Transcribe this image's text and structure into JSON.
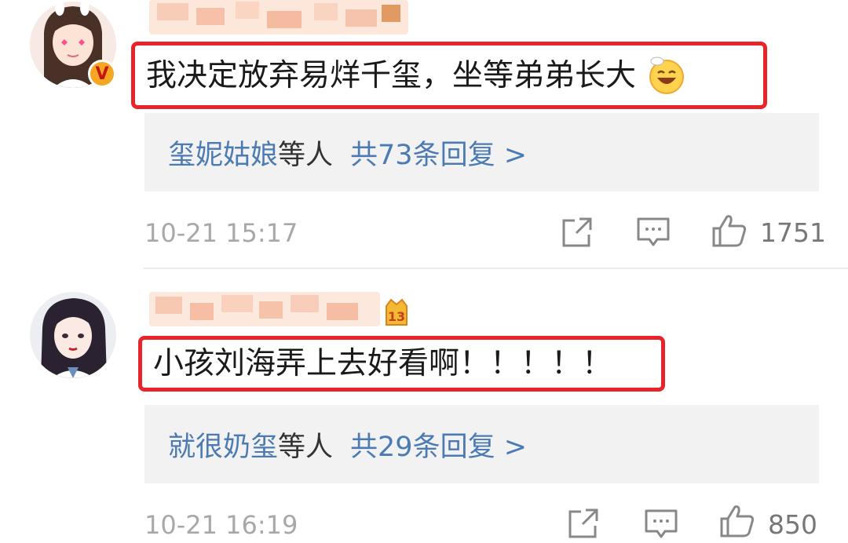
{
  "comments": [
    {
      "text": "我决定放弃易烊千玺，坐等弟弟长大",
      "reply_prefix_names": "玺妮姑娘",
      "reply_prefix_suffix": "等人",
      "reply_count_text": "共73条回复 >",
      "timestamp": "10-21 15:17",
      "likes": "1751",
      "badge_icon": "verified-v-badge",
      "trailing_emoji": "grinning-face-emoji"
    },
    {
      "text": "小孩刘海弄上去好看啊！！！！！",
      "reply_prefix_names": "就很奶玺",
      "reply_prefix_suffix": "等人",
      "reply_count_text": "共29条回复 >",
      "timestamp": "10-21 16:19",
      "likes": "850",
      "badge_icon": "fan-level-badge"
    }
  ],
  "colors": {
    "highlight_border": "#e8232a",
    "link_blue": "#4c7bb3",
    "reply_bg": "#f2f2f2",
    "meta_gray": "#a8a8a8"
  },
  "icons": [
    "share-icon",
    "comment-icon",
    "like-icon"
  ]
}
